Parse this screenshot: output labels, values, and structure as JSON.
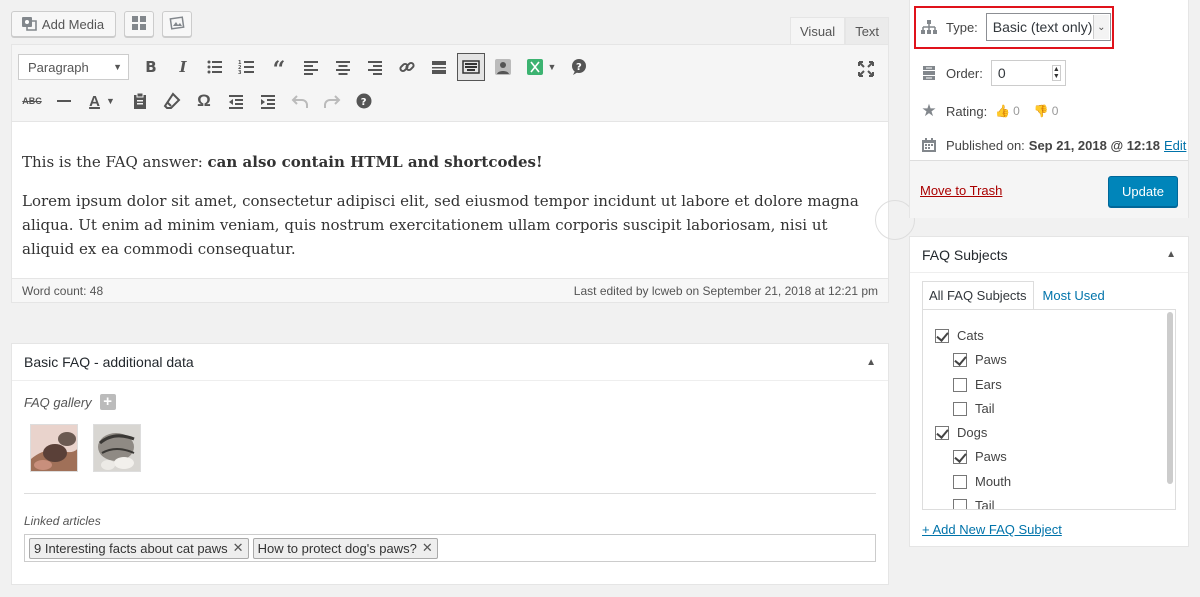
{
  "media": {
    "add_media_label": "Add Media"
  },
  "editor_tabs": {
    "visual": "Visual",
    "text": "Text"
  },
  "toolbar": {
    "format_value": "Paragraph"
  },
  "content": {
    "p1_plain": "This is the FAQ answer: ",
    "p1_bold": "can also contain HTML and shortcodes!",
    "p2": "Lorem ipsum dolor sit amet, consectetur adipisci elit, sed eiusmod tempor incidunt ut labore et dolore magna aliqua. Ut enim ad minim veniam, quis nostrum exercitationem ullam corporis suscipit laboriosam, nisi ut aliquid ex ea commodi consequatur."
  },
  "status": {
    "word_count": "Word count: 48",
    "last_edited": "Last edited by lcweb on September 21, 2018 at 12:21 pm"
  },
  "faq_box": {
    "title": "Basic FAQ - additional data",
    "gallery_label": "FAQ gallery",
    "linked_label": "Linked articles",
    "linked_articles": [
      "9 Interesting facts about cat paws",
      "How to protect dog's paws?"
    ]
  },
  "publish": {
    "type_label": "Type:",
    "type_value": "Basic (text only)",
    "order_label": "Order:",
    "order_value": "0",
    "rating_label": "Rating:",
    "rating_up": "0",
    "rating_down": "0",
    "published_label": "Published on:",
    "published_value": "Sep 21, 2018 @ 12:18",
    "edit_link": "Edit",
    "trash_link": "Move to Trash",
    "update_button": "Update"
  },
  "subjects": {
    "title": "FAQ Subjects",
    "tab_all": "All FAQ Subjects",
    "tab_most_used": "Most Used",
    "items": [
      {
        "label": "Cats",
        "checked": true
      },
      {
        "label": "Paws",
        "checked": true
      },
      {
        "label": "Ears",
        "checked": false
      },
      {
        "label": "Tail",
        "checked": false
      },
      {
        "label": "Dogs",
        "checked": true
      },
      {
        "label": "Paws",
        "checked": true
      },
      {
        "label": "Mouth",
        "checked": false
      },
      {
        "label": "Tail",
        "checked": false
      }
    ],
    "add_new": "+ Add New FAQ Subject"
  }
}
